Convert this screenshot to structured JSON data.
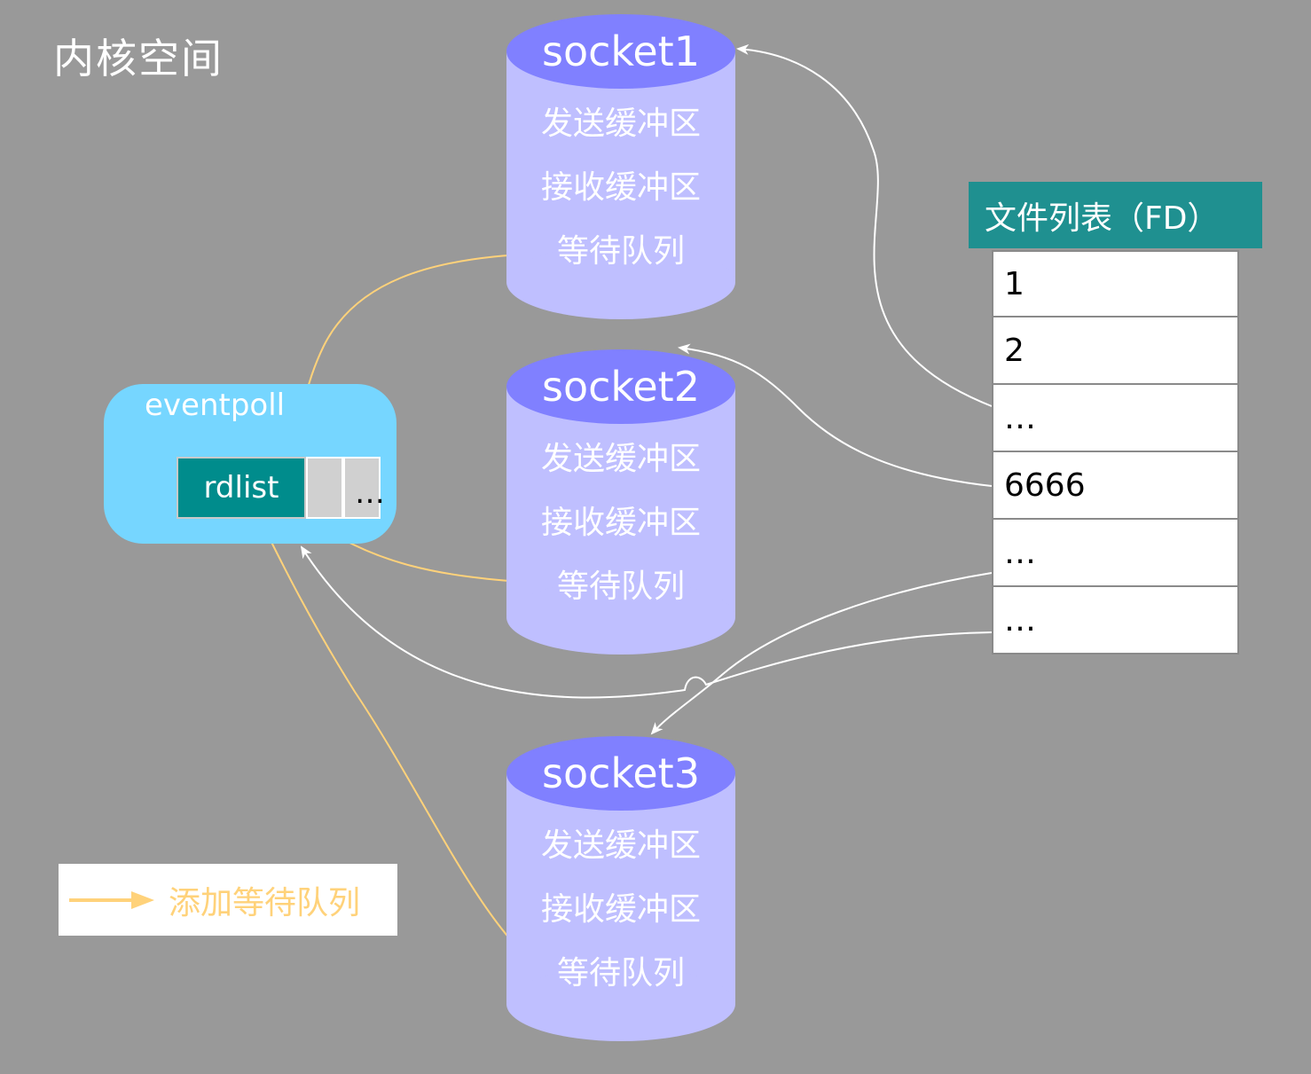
{
  "title": "内核空间",
  "colors": {
    "background": "#999999",
    "cylinder_top": "#8080ff",
    "cylinder_body": "#bfbfff",
    "eventpoll": "#76d6ff",
    "rdlist": "#008c8c",
    "fd_header": "#1f9090",
    "add_wait_arrow": "#ffd27a",
    "reference_arrow": "#ffffff"
  },
  "sockets": [
    {
      "name": "socket1",
      "lines": [
        "发送缓冲区",
        "接收缓冲区",
        "等待队列"
      ]
    },
    {
      "name": "socket2",
      "lines": [
        "发送缓冲区",
        "接收缓冲区",
        "等待队列"
      ]
    },
    {
      "name": "socket3",
      "lines": [
        "发送缓冲区",
        "接收缓冲区",
        "等待队列"
      ]
    }
  ],
  "eventpoll": {
    "label": "eventpoll",
    "rdlist_label": "rdlist",
    "ellipsis": "…"
  },
  "fd_list": {
    "header": "文件列表（FD）",
    "rows": [
      "1",
      "2",
      "…",
      "6666",
      "…",
      "…"
    ]
  },
  "legend": {
    "label": "添加等待队列"
  }
}
